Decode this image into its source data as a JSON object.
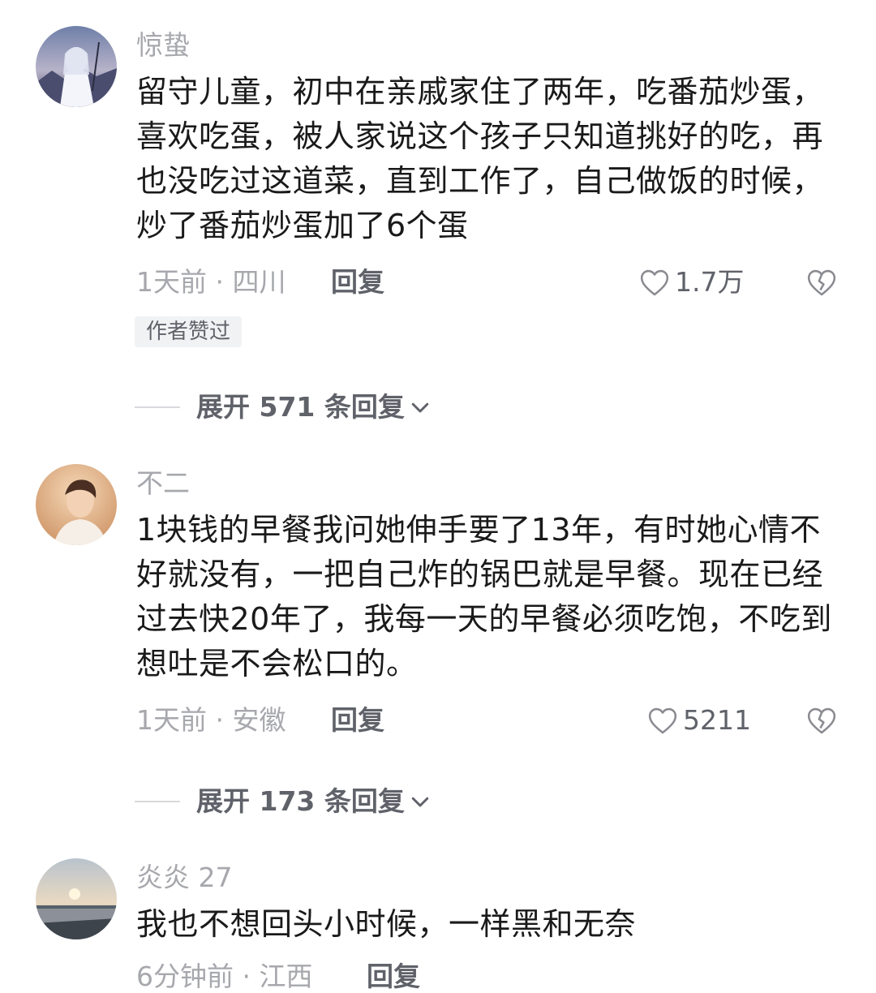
{
  "comments": [
    {
      "username": "惊蛰",
      "content": "留守儿童，初中在亲戚家住了两年，吃番茄炒蛋，喜欢吃蛋，被人家说这个孩子只知道挑好的吃，再也没吃过这道菜，直到工作了，自己做饭的时候，炒了番茄炒蛋加了6个蛋",
      "meta": "1天前 · 四川",
      "reply_label": "回复",
      "like_count": "1.7万",
      "badge": "作者赞过",
      "expand_label": "展开 571 条回复"
    },
    {
      "username": "不二",
      "content": "1块钱的早餐我问她伸手要了13年，有时她心情不好就没有，一把自己炸的锅巴就是早餐。现在已经过去快20年了，我每一天的早餐必须吃饱，不吃到想吐是不会松口的。",
      "meta": "1天前 · 安徽",
      "reply_label": "回复",
      "like_count": "5211",
      "expand_label": "展开 173 条回复"
    },
    {
      "username": "炎炎 27",
      "content": "我也不想回头小时候，一样黑和无奈",
      "meta": "6分钟前 · 江西",
      "reply_label": "回复"
    }
  ],
  "icons": {
    "like": "heart-outline-icon",
    "dislike": "broken-heart-icon",
    "expand": "chevron-down-icon"
  },
  "colors": {
    "secondary_text": "#a7a8ad",
    "action_text": "#60626a",
    "body_text": "#1a1a1a",
    "badge_bg": "#f1f2f4"
  }
}
